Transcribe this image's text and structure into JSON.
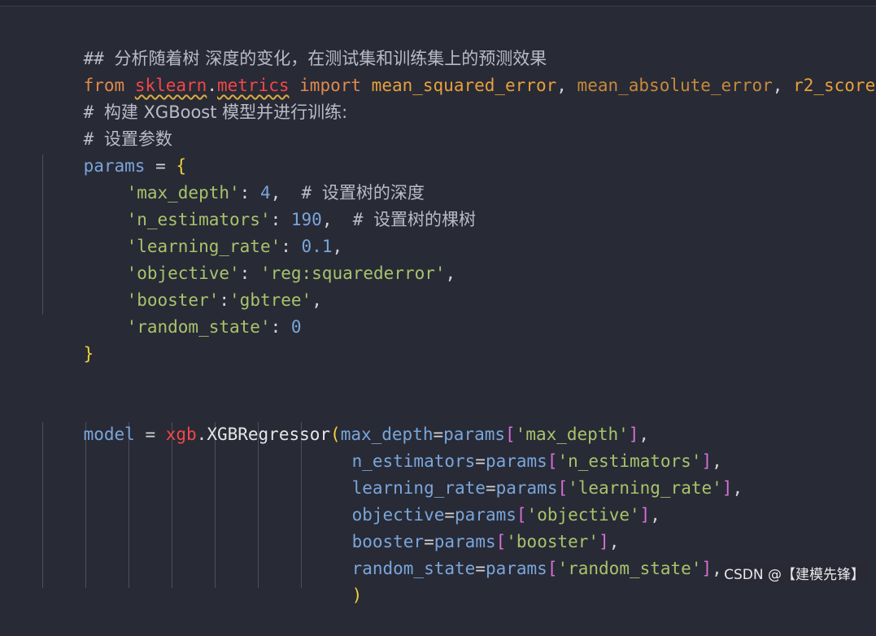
{
  "editor": {
    "lines": {
      "l1": {
        "hash": "## ",
        "text": "分析随着树 深度的变化，在测试集和训练集上的预测效果"
      },
      "l2": {
        "from": "from",
        "pkg": "sklearn",
        "dot": ".",
        "sub": "metrics",
        "import": "import",
        "n1": "mean_squared_error",
        "c1": ", ",
        "n2": "mean_absolute_error",
        "c2": ", ",
        "n3": "r2_score"
      },
      "l3": {
        "hash": "# ",
        "text": "构建 XGBoost 模型并进行训练:"
      },
      "l4": {
        "hash": "# ",
        "text": "设置参数"
      },
      "l5": {
        "var": "params",
        "eq": " = ",
        "brace": "{"
      },
      "l6": {
        "key": "'max_depth'",
        "colon": ": ",
        "val": "4",
        "rest": ",  ",
        "hash": "# ",
        "comment": "设置树的深度"
      },
      "l7": {
        "key": "'n_estimators'",
        "colon": ": ",
        "val": "190",
        "rest": ",  ",
        "hash": "# ",
        "comment": "设置树的棵树"
      },
      "l8": {
        "key": "'learning_rate'",
        "colon": ": ",
        "val": "0.1",
        "rest": ","
      },
      "l9": {
        "key": "'objective'",
        "colon": ": ",
        "val": "'reg:squarederror'",
        "rest": ","
      },
      "l10": {
        "key": "'booster'",
        "colon": ":",
        "val": "'gbtree'",
        "rest": ","
      },
      "l11": {
        "key": "'random_state'",
        "colon": ": ",
        "val": "0"
      },
      "l12": {
        "brace": "}"
      },
      "l13": {
        "var": "model",
        "eq": " = ",
        "mod": "xgb",
        "dot": ".",
        "cls": "XGBRegressor",
        "paren": "(",
        "arg": "max_depth",
        "aeq": "=",
        "p": "params",
        "lb": "[",
        "key": "'max_depth'",
        "rb": "]",
        "comma": ","
      },
      "l14": {
        "arg": "n_estimators",
        "aeq": "=",
        "p": "params",
        "lb": "[",
        "key": "'n_estimators'",
        "rb": "]",
        "comma": ","
      },
      "l15": {
        "arg": "learning_rate",
        "aeq": "=",
        "p": "params",
        "lb": "[",
        "key": "'learning_rate'",
        "rb": "]",
        "comma": ","
      },
      "l16": {
        "arg": "objective",
        "aeq": "=",
        "p": "params",
        "lb": "[",
        "key": "'objective'",
        "rb": "]",
        "comma": ","
      },
      "l17": {
        "arg": "booster",
        "aeq": "=",
        "p": "params",
        "lb": "[",
        "key": "'booster'",
        "rb": "]",
        "comma": ","
      },
      "l18": {
        "arg": "random_state",
        "aeq": "=",
        "p": "params",
        "lb": "[",
        "key": "'random_state'",
        "rb": "]",
        "comma": ","
      },
      "l19": {
        "paren": ")"
      }
    }
  },
  "watermark": {
    "text": "CSDN @【建模先锋】"
  },
  "colors": {
    "background": "#282a36",
    "comment": "#b9bcc6",
    "keyword": "#e08a4b",
    "variable": "#7aa6da",
    "string": "#a8c36b",
    "brace": "#f0d237",
    "bracket": "#d670d6",
    "error": "#f44747"
  }
}
